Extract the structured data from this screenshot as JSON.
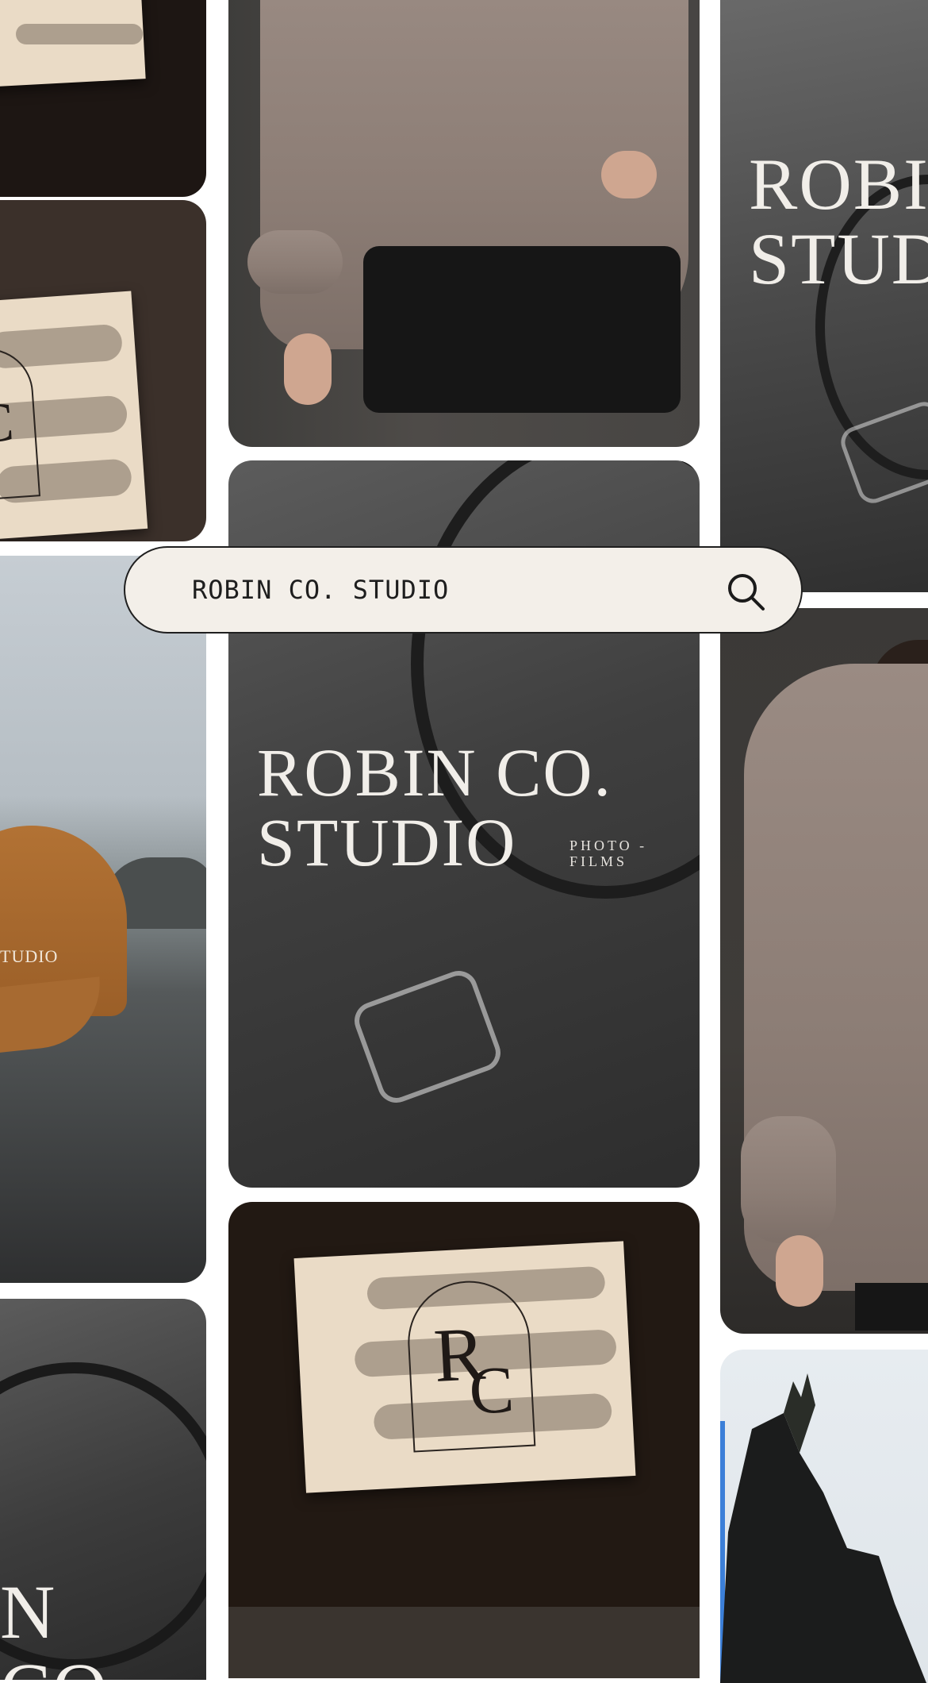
{
  "search": {
    "query": "ROBIN CO. STUDIO",
    "icon": "search-icon"
  },
  "brand": {
    "wordmark_primary": "ROBIN CO.\nSTUDIO",
    "tagline": "PHOTO -\nFILMS",
    "wordmark_side": "ROBIN\nSTUDIO",
    "cap_text": "TUDIO",
    "partial_wordmark": "N CO.",
    "monogram_top": "R",
    "monogram_bottom": "C",
    "monogram_small": "C"
  },
  "colors": {
    "search_bg": "#f3efe9",
    "card_cream": "#eadbc6",
    "sweater": "#8f817a",
    "cap": "#a6662e"
  }
}
